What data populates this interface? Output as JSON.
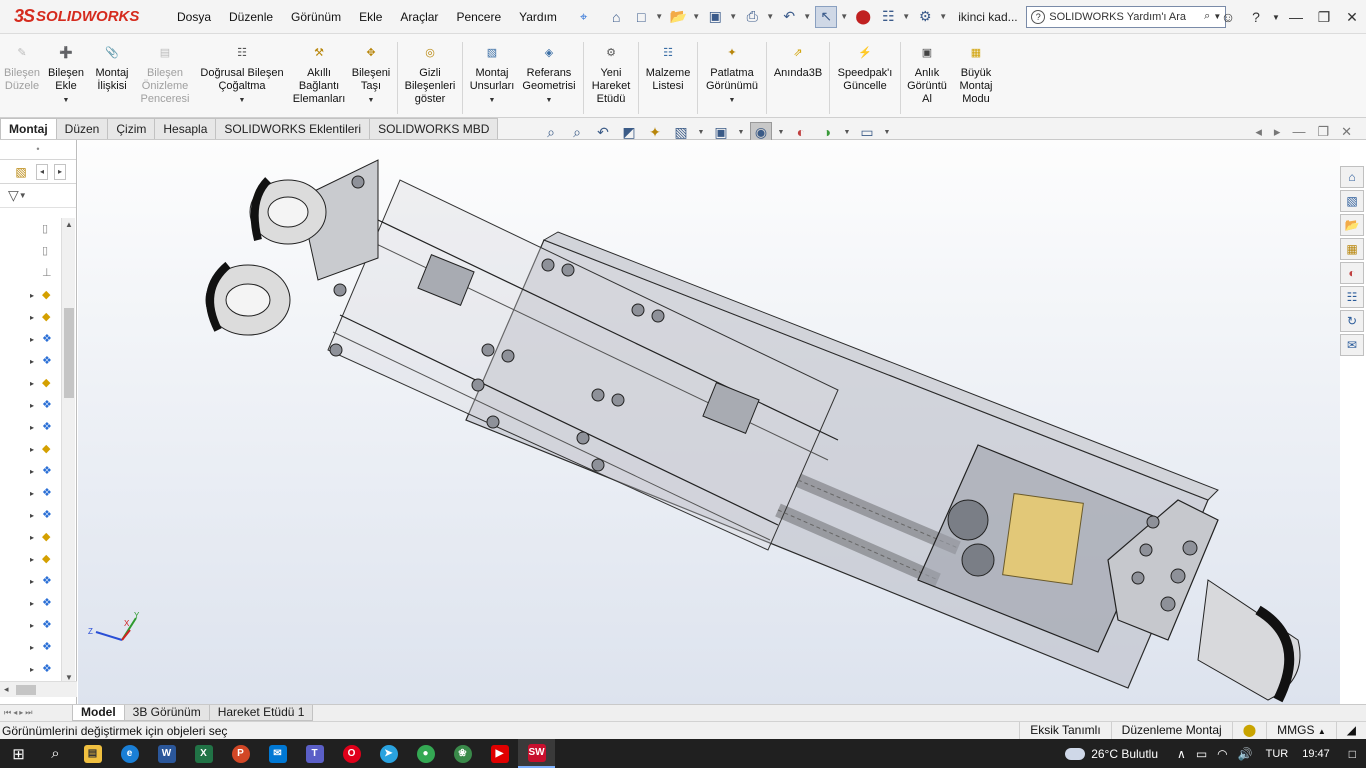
{
  "app": {
    "logo_ds": "3S",
    "logo_text": "SOLIDWORKS",
    "menus": [
      "Dosya",
      "Düzenle",
      "Görünüm",
      "Ekle",
      "Araçlar",
      "Pencere",
      "Yardım"
    ],
    "user": "ikinci kad...",
    "search_placeholder": "SOLIDWORKS Yardım'ı Ara"
  },
  "ribbon": {
    "buttons": [
      {
        "label": "Bileşen Düzele",
        "enabled": false
      },
      {
        "label": "Bileşen Ekle",
        "enabled": true
      },
      {
        "label": "Montaj İlişkisi",
        "enabled": true
      },
      {
        "label": "Bileşen Önizleme Penceresi",
        "enabled": false
      },
      {
        "label": "Doğrusal Bileşen Çoğaltma",
        "enabled": true
      },
      {
        "label": "Akıllı Bağlantı Elemanları",
        "enabled": true
      },
      {
        "label": "Bileşeni Taşı",
        "enabled": true
      },
      {
        "label": "Gizli Bileşenleri göster",
        "enabled": true
      },
      {
        "label": "Montaj Unsurları",
        "enabled": true
      },
      {
        "label": "Referans Geometrisi",
        "enabled": true
      },
      {
        "label": "Yeni Hareket Etüdü",
        "enabled": true
      },
      {
        "label": "Malzeme Listesi",
        "enabled": true
      },
      {
        "label": "Patlatma Görünümü",
        "enabled": true
      },
      {
        "label": "Anında3B",
        "enabled": true
      },
      {
        "label": "Speedpak'ı Güncelle",
        "enabled": true
      },
      {
        "label": "Anlık Görüntü Al",
        "enabled": true
      },
      {
        "label": "Büyük Montaj Modu",
        "enabled": true
      }
    ]
  },
  "cm_tabs": [
    "Montaj",
    "Düzen",
    "Çizim",
    "Hesapla",
    "SOLIDWORKS Eklentileri",
    "SOLIDWORKS MBD"
  ],
  "model_tabs": [
    "Model",
    "3B Görünüm",
    "Hareket Etüdü 1"
  ],
  "status": {
    "message": "Görünümlerini değiştirmek için objeleri seç",
    "definition": "Eksik Tanımlı",
    "mode": "Düzenleme Montaj",
    "units": "MMGS"
  },
  "triad": {
    "x": "X",
    "y": "Y",
    "z": "Z"
  },
  "taskbar": {
    "weather": "26°C  Bulutlu",
    "lang": "TUR",
    "time": "19:47"
  },
  "colors": {
    "brand": "#d52b1e",
    "accent": "#2a6fd6"
  }
}
